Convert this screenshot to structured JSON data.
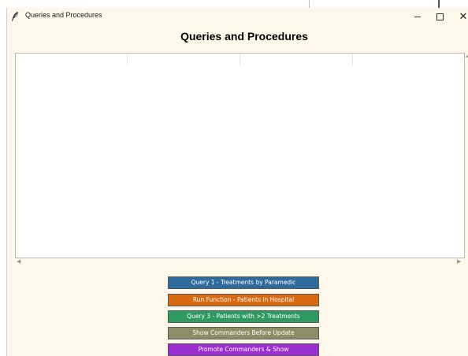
{
  "window": {
    "title": "Queries and Procedures"
  },
  "heading": "Queries and Procedures",
  "buttons": {
    "query1": "Query 1 - Treatments by Paramedic",
    "run_function": "Run Function - Patients in Hospital",
    "query3": "Query 3 - Patients with >2 Treatments",
    "show_commanders": "Show Commanders Before Update",
    "promote_commanders": "Promote Commanders & Show"
  },
  "colors": {
    "window_bg": "#fdf8ea",
    "query1": "#2f6a9c",
    "run_function": "#d86a12",
    "query3": "#2e9a62",
    "show_commanders": "#8c8f65",
    "promote_commanders": "#9a2ed1"
  },
  "icons": {
    "app": "feather-icon",
    "minimize": "minimize-icon",
    "maximize": "maximize-icon",
    "close": "close-icon",
    "scroll_left": "scroll-left-arrow-icon",
    "scroll_right": "scroll-right-arrow-icon"
  }
}
